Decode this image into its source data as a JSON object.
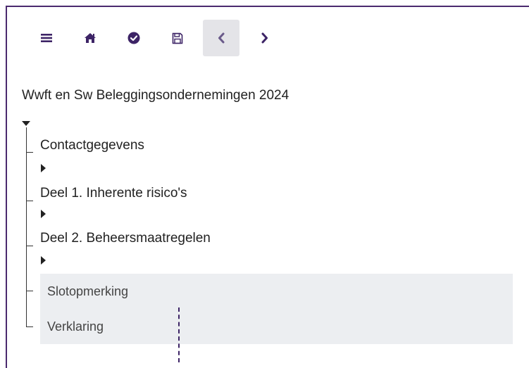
{
  "toolbar": {
    "buttons": [
      {
        "icon": "menu-icon"
      },
      {
        "icon": "home-icon"
      },
      {
        "icon": "check-circle-icon"
      },
      {
        "icon": "save-icon"
      },
      {
        "icon": "chevron-left-icon",
        "active": true
      },
      {
        "icon": "chevron-right-icon"
      }
    ],
    "icon_color": "#3d2466"
  },
  "tree": {
    "title": "Wwft en Sw Beleggingsondernemingen 2024",
    "nodes": [
      {
        "label": "Contactgegevens",
        "expanded": false
      },
      {
        "label": "Deel 1. Inherente risico's",
        "expanded": false
      },
      {
        "label": "Deel 2. Beheersmaatregelen",
        "expanded": false
      }
    ],
    "leaves": [
      {
        "label": "Slotopmerking"
      },
      {
        "label": "Verklaring"
      }
    ]
  }
}
